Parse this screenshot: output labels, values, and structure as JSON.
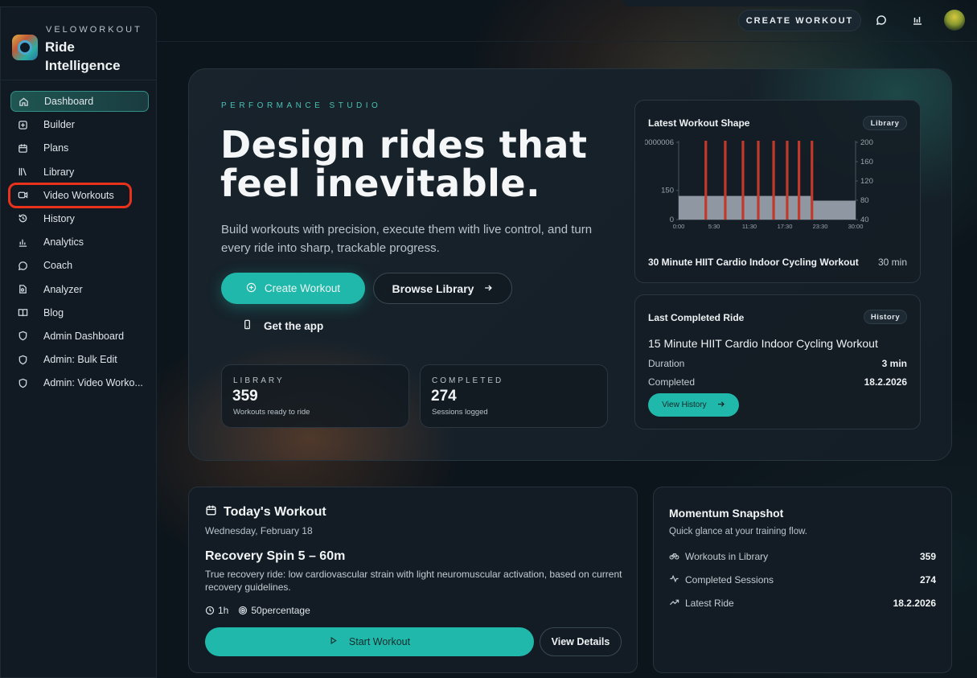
{
  "brand": {
    "small": "VELOWORKOUT",
    "title": "Ride Intelligence"
  },
  "nav": [
    {
      "label": "Dashboard",
      "icon": "home-icon"
    },
    {
      "label": "Builder",
      "icon": "plus-square-icon"
    },
    {
      "label": "Plans",
      "icon": "calendar-icon"
    },
    {
      "label": "Library",
      "icon": "library-icon"
    },
    {
      "label": "Video Workouts",
      "icon": "video-icon"
    },
    {
      "label": "History",
      "icon": "history-icon"
    },
    {
      "label": "Analytics",
      "icon": "bar-chart-icon"
    },
    {
      "label": "Coach",
      "icon": "chat-icon"
    },
    {
      "label": "Analyzer",
      "icon": "file-analyze-icon"
    },
    {
      "label": "Blog",
      "icon": "book-icon"
    },
    {
      "label": "Admin Dashboard",
      "icon": "shield-icon"
    },
    {
      "label": "Admin: Bulk Edit",
      "icon": "shield-icon"
    },
    {
      "label": "Admin: Video Worko...",
      "icon": "shield-icon"
    }
  ],
  "topbar": {
    "create_label": "CREATE WORKOUT"
  },
  "hero": {
    "eyebrow": "PERFORMANCE STUDIO",
    "title": "Design rides that feel inevitable.",
    "subtitle": "Build workouts with precision, execute them with live control, and turn every ride into sharp, trackable progress.",
    "create_label": "Create Workout",
    "browse_label": "Browse Library",
    "app_label": "Get the app",
    "stats": [
      {
        "label": "LIBRARY",
        "value": "359",
        "note": "Workouts ready to ride"
      },
      {
        "label": "COMPLETED",
        "value": "274",
        "note": "Sessions logged"
      }
    ]
  },
  "latest_shape": {
    "title": "Latest Workout Shape",
    "tag": "Library",
    "workout_name": "30 Minute HIIT Cardio Indoor Cycling Workout",
    "duration": "30 min",
    "chart_data": {
      "type": "bar",
      "left_ticks": [
        "0000006",
        "150",
        "0"
      ],
      "right_ticks": [
        "200",
        "160",
        "120",
        "80",
        "40"
      ],
      "x_ticks": [
        "0:00",
        "5:30",
        "11:30",
        "17:30",
        "23:30",
        "30:00"
      ],
      "x_minutes": [
        0,
        30
      ],
      "base_segments": [
        {
          "start_min": 0,
          "end_min": 22.5,
          "level": 0.3
        },
        {
          "start_min": 22.5,
          "end_min": 30,
          "level": 0.24
        }
      ],
      "intervals_min": [
        4.6,
        7.9,
        10.9,
        13.5,
        16.1,
        18.4,
        20.4,
        22.6
      ],
      "interval_color": "#c0392b",
      "base_color": "#8f97a3"
    }
  },
  "last_completed": {
    "title": "Last Completed Ride",
    "tag": "History",
    "workout_name": "15 Minute HIIT Cardio Indoor Cycling Workout",
    "duration_label": "Duration",
    "duration_value": "3 min",
    "completed_label": "Completed",
    "completed_value": "18.2.2026",
    "button_label": "View History"
  },
  "today": {
    "title": "Today's Workout",
    "date": "Wednesday, February 18",
    "name": "Recovery Spin 5 – 60m",
    "description": "True recovery ride: low cardiovascular strain with light neuromuscular activation, based on current recovery guidelines.",
    "duration": "1h",
    "intensity": "50percentage",
    "start_label": "Start Workout",
    "details_label": "View Details"
  },
  "momentum": {
    "title": "Momentum Snapshot",
    "subtitle": "Quick glance at your training flow.",
    "rows": [
      {
        "label": "Workouts in Library",
        "value": "359",
        "icon": "bike-icon"
      },
      {
        "label": "Completed Sessions",
        "value": "274",
        "icon": "pulse-icon"
      },
      {
        "label": "Latest Ride",
        "value": "18.2.2026",
        "icon": "trend-icon"
      }
    ]
  },
  "colors": {
    "accent": "#20b8aa",
    "highlight": "#e8321c",
    "interval": "#c0392b"
  }
}
